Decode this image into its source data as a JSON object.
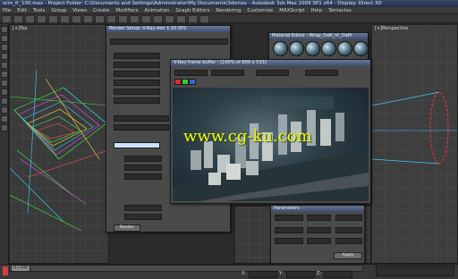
{
  "window": {
    "title": "scm_fr_100.max - Project Folder: C:\\Documents and Settings\\Administrator\\My Documents\\3dsmax - Autodesk 3ds Max 2009 SP1 x64 - Display: Direct 3D"
  },
  "menu": [
    "File",
    "Edit",
    "Tools",
    "Group",
    "Views",
    "Create",
    "Modifiers",
    "Animation",
    "Graph Editors",
    "Rendering",
    "Customize",
    "MAXScript",
    "Help",
    "Tentacles"
  ],
  "viewports": {
    "top_left_label": "[+]Top",
    "right_label": "[+]Perspective"
  },
  "dialogs": {
    "render_setup_title": "Render Setup: V-Ray Adv 1.50.SP2",
    "material_editor_title": "Material Editor - Wrap_DaR_nt_DaM",
    "frame_buffer_title": "V-Ray frame buffer - [100% of 800 x 533]",
    "frame_buffer_channel_label": "RGB color",
    "params_title": "Parameters",
    "render_button": "Render",
    "apply_button": "Apply"
  },
  "watermark": "www.cg-ku.com",
  "status": {
    "frame_counter": "0 / 100",
    "coords": [
      "X:",
      "Y:",
      "Z:"
    ]
  },
  "colors": {
    "vray_window_bg": "#1d2a33",
    "watermark": "#e8ff00"
  }
}
